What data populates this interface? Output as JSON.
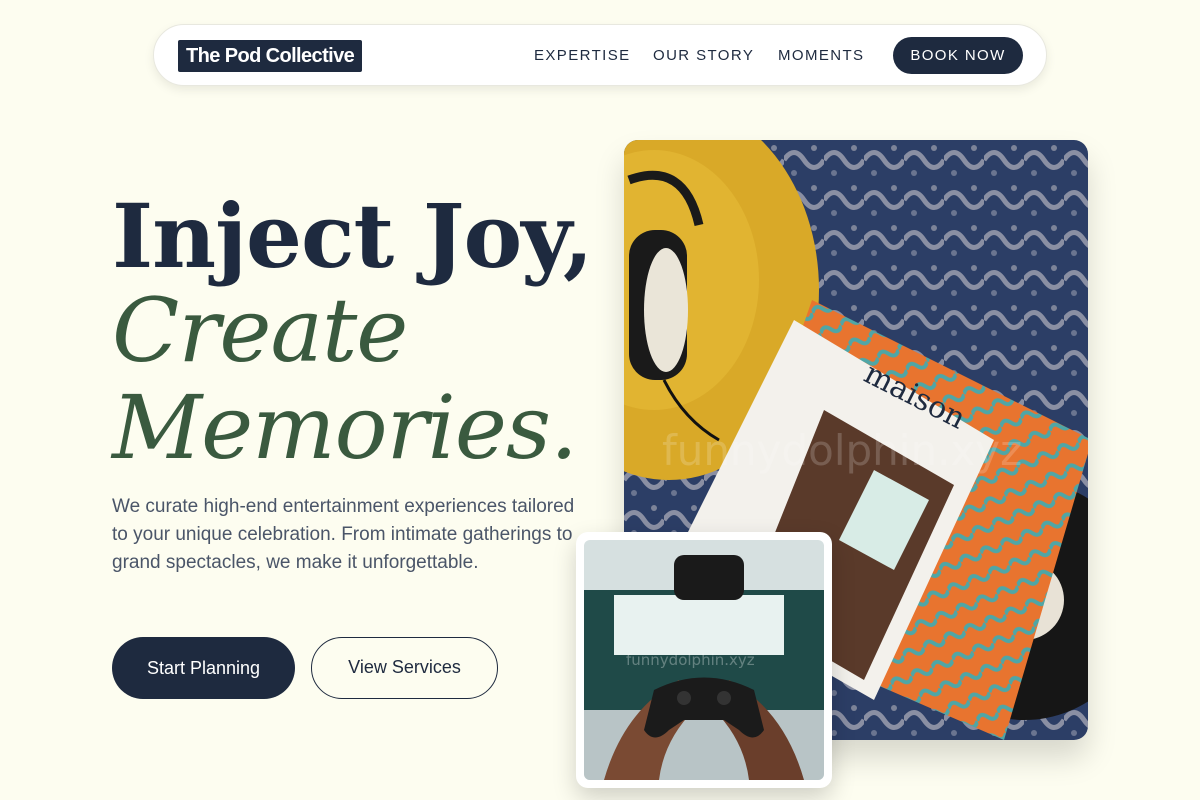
{
  "brand": {
    "name": "The Pod Collective"
  },
  "nav": {
    "links": [
      "EXPERTISE",
      "OUR STORY",
      "MOMENTS"
    ],
    "cta": "BOOK NOW"
  },
  "hero": {
    "line1": "Inject Joy,",
    "line2": "Create",
    "line3": "Memories.",
    "description": "We curate high-end entertainment experiences tailored to your unique celebration. From intimate gatherings to grand spectacles, we make it unforgettable.",
    "primary_button": "Start Planning",
    "secondary_button": "View Services"
  },
  "images": {
    "main": {
      "magazine_title": "maison",
      "watermark": "funnydolphin.xyz"
    },
    "secondary": {
      "watermark": "funnydolphin.xyz"
    }
  },
  "colors": {
    "background": "#fdfdf0",
    "navy": "#1e2a3f",
    "green": "#3a5a3f",
    "body_text": "#4a5568"
  }
}
